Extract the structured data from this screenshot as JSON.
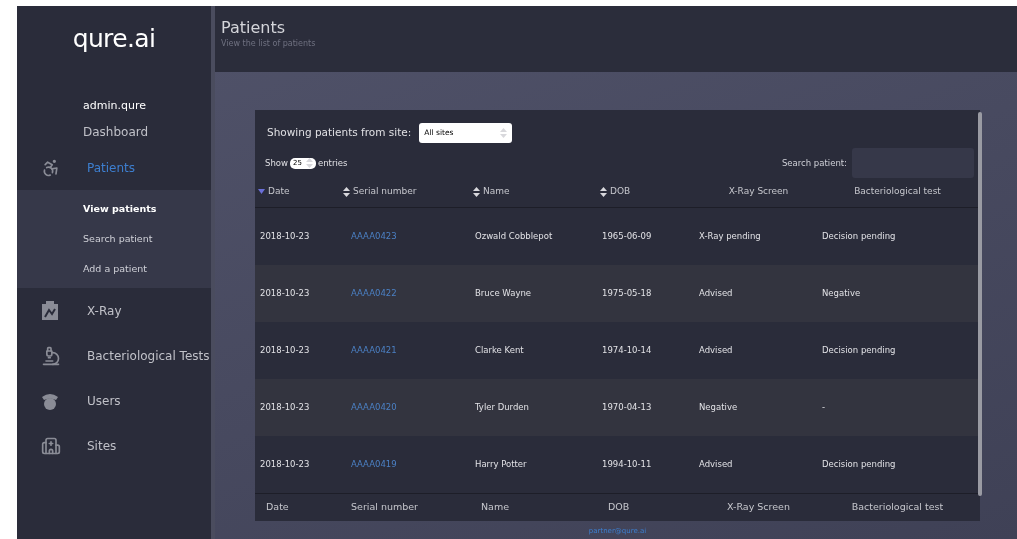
{
  "sidebar": {
    "logo": "qure.ai",
    "user": "admin.qure",
    "items": [
      {
        "label": "Dashboard",
        "selected": false
      },
      {
        "label": "Patients",
        "selected": true,
        "children": [
          {
            "label": "View patients",
            "selected": true
          },
          {
            "label": "Search patient",
            "selected": false
          },
          {
            "label": "Add a patient",
            "selected": false
          }
        ]
      },
      {
        "label": "X-Ray",
        "selected": false
      },
      {
        "label": "Bacteriological Tests",
        "selected": false
      },
      {
        "label": "Users",
        "selected": false
      },
      {
        "label": "Sites",
        "selected": false
      }
    ]
  },
  "header": {
    "title": "Patients",
    "subtitle": "View the list of patients"
  },
  "filters": {
    "site_label": "Showing patients from site:",
    "site_value": "All sites",
    "show_label": "Show",
    "page_size": "25",
    "entries_label": "entries",
    "search_label": "Search patient:"
  },
  "table": {
    "columns": [
      {
        "label": "Date",
        "sortable": true,
        "sorted": true
      },
      {
        "label": "Serial number",
        "sortable": true,
        "sorted": false
      },
      {
        "label": "Name",
        "sortable": true,
        "sorted": false
      },
      {
        "label": "DOB",
        "sortable": true,
        "sorted": false
      },
      {
        "label": "X-Ray Screen",
        "sortable": false,
        "sorted": false
      },
      {
        "label": "Bacteriological test",
        "sortable": false,
        "sorted": false
      }
    ],
    "rows": [
      [
        "2018-10-23",
        "AAAA0423",
        "Ozwald Cobblepot",
        "1965-06-09",
        "X-Ray pending",
        "Decision pending"
      ],
      [
        "2018-10-23",
        "AAAA0422",
        "Bruce Wayne",
        "1975-05-18",
        "Advised",
        "Negative"
      ],
      [
        "2018-10-23",
        "AAAA0421",
        "Clarke Kent",
        "1974-10-14",
        "Advised",
        "Decision pending"
      ],
      [
        "2018-10-23",
        "AAAA0420",
        "Tyler Durden",
        "1970-04-13",
        "Negative",
        "-"
      ],
      [
        "2018-10-23",
        "AAAA0419",
        "Harry Potter",
        "1994-10-11",
        "Advised",
        "Decision pending"
      ]
    ],
    "footer": [
      "Date",
      "Serial number",
      "Name",
      "DOB",
      "X-Ray Screen",
      "Bacteriological test"
    ]
  },
  "footer_email": "partner@qure.ai"
}
